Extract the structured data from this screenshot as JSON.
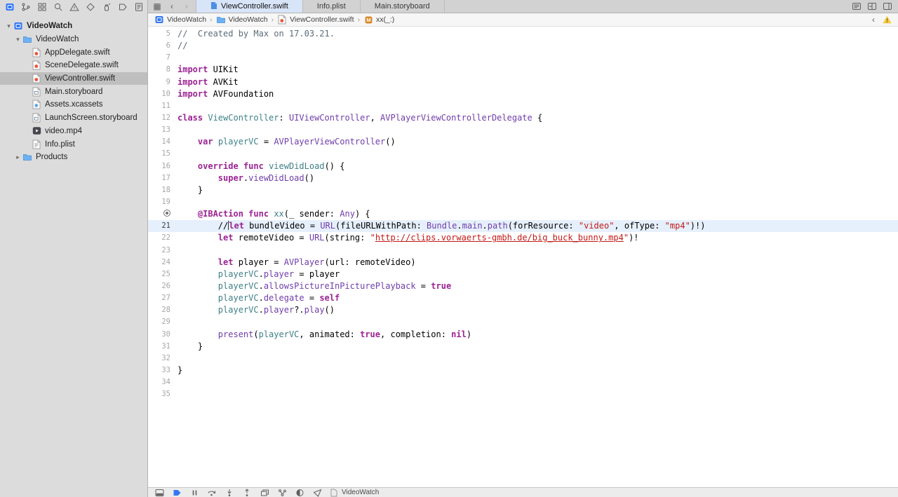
{
  "colors": {
    "accent_blue": "#3478f6",
    "active_tab_bg": "#d8e4f8",
    "highlight_line_bg": "#e6f0fc",
    "keyword": "#9b2393",
    "string": "#c41a16",
    "comment": "#5d6c79",
    "project_symbol": "#3e8087",
    "sdk_symbol": "#703daa",
    "warning_yellow": "#f7c93d",
    "swift_orange": "#f05138"
  },
  "navigator_bar": {
    "icons": [
      {
        "name": "project-navigator-icon",
        "selected": true
      },
      {
        "name": "source-control-navigator-icon",
        "selected": false
      },
      {
        "name": "symbol-navigator-icon",
        "selected": false
      },
      {
        "name": "find-navigator-icon",
        "selected": false
      },
      {
        "name": "issue-navigator-icon",
        "selected": false
      },
      {
        "name": "test-navigator-icon",
        "selected": false
      },
      {
        "name": "debug-navigator-icon",
        "selected": false
      },
      {
        "name": "breakpoint-navigator-icon",
        "selected": false
      },
      {
        "name": "report-navigator-icon",
        "selected": false
      }
    ]
  },
  "sidebar": {
    "items": [
      {
        "label": "VideoWatch",
        "icon": "project",
        "level": 0,
        "disclosure": "open",
        "selected": false,
        "bold": true
      },
      {
        "label": "VideoWatch",
        "icon": "folder",
        "level": 1,
        "disclosure": "open",
        "selected": false
      },
      {
        "label": "AppDelegate.swift",
        "icon": "swift",
        "level": 2,
        "selected": false
      },
      {
        "label": "SceneDelegate.swift",
        "icon": "swift",
        "level": 2,
        "selected": false
      },
      {
        "label": "ViewController.swift",
        "icon": "swift",
        "level": 2,
        "selected": true
      },
      {
        "label": "Main.storyboard",
        "icon": "storyboard",
        "level": 2,
        "selected": false
      },
      {
        "label": "Assets.xcassets",
        "icon": "xcassets",
        "level": 2,
        "selected": false
      },
      {
        "label": "LaunchScreen.storyboard",
        "icon": "storyboard",
        "level": 2,
        "selected": false
      },
      {
        "label": "video.mp4",
        "icon": "media",
        "level": 2,
        "selected": false
      },
      {
        "label": "Info.plist",
        "icon": "plist",
        "level": 2,
        "selected": false
      },
      {
        "label": "Products",
        "icon": "folder",
        "level": 1,
        "disclosure": "closed",
        "selected": false
      }
    ]
  },
  "tab_bar": {
    "left_icons": [
      "related-items-icon",
      "go-back-icon",
      "go-forward-icon"
    ],
    "tabs": [
      {
        "label": "ViewController.swift",
        "active": true,
        "icon": "swift-file"
      },
      {
        "label": "Info.plist",
        "active": false
      },
      {
        "label": "Main.storyboard",
        "active": false
      }
    ],
    "right_icons": [
      "editor-options-icon",
      "add-editor-icon",
      "inspector-toggle-icon"
    ]
  },
  "jump_bar": {
    "items": [
      {
        "label": "VideoWatch",
        "icon": "project"
      },
      {
        "label": "VideoWatch",
        "icon": "folder"
      },
      {
        "label": "ViewController.swift",
        "icon": "swift"
      },
      {
        "label": "xx(_:)",
        "icon": "method"
      }
    ],
    "right_icons": [
      "chevron-left-icon",
      "warning-icon"
    ]
  },
  "editor": {
    "first_visible_line": 5,
    "highlight_line": 21,
    "ibaction_line": 20,
    "lines": [
      {
        "num": 5,
        "t": [
          [
            "c",
            "//  Created by Max on 17.03.21."
          ]
        ]
      },
      {
        "num": 6,
        "t": [
          [
            "c",
            "//"
          ]
        ]
      },
      {
        "num": 7,
        "t": []
      },
      {
        "num": 8,
        "t": [
          [
            "k",
            "import"
          ],
          [
            "pl",
            " UIKit"
          ]
        ]
      },
      {
        "num": 9,
        "t": [
          [
            "k",
            "import"
          ],
          [
            "pl",
            " AVKit"
          ]
        ]
      },
      {
        "num": 10,
        "t": [
          [
            "k",
            "import"
          ],
          [
            "pl",
            " AVFoundation"
          ]
        ]
      },
      {
        "num": 11,
        "t": []
      },
      {
        "num": 12,
        "t": [
          [
            "k",
            "class"
          ],
          [
            "pl",
            " "
          ],
          [
            "t",
            "ViewController"
          ],
          [
            "pl",
            ": "
          ],
          [
            "p",
            "UIViewController"
          ],
          [
            "pl",
            ", "
          ],
          [
            "p",
            "AVPlayerViewControllerDelegate"
          ],
          [
            "pl",
            " {"
          ]
        ]
      },
      {
        "num": 13,
        "t": []
      },
      {
        "num": 14,
        "t": [
          [
            "pl",
            "    "
          ],
          [
            "k",
            "var"
          ],
          [
            "pl",
            " "
          ],
          [
            "t",
            "playerVC"
          ],
          [
            "pl",
            " = "
          ],
          [
            "p",
            "AVPlayerViewController"
          ],
          [
            "pl",
            "()"
          ]
        ]
      },
      {
        "num": 15,
        "t": []
      },
      {
        "num": 16,
        "t": [
          [
            "pl",
            "    "
          ],
          [
            "k",
            "override"
          ],
          [
            "pl",
            " "
          ],
          [
            "k",
            "func"
          ],
          [
            "pl",
            " "
          ],
          [
            "t",
            "viewDidLoad"
          ],
          [
            "pl",
            "() {"
          ]
        ]
      },
      {
        "num": 17,
        "t": [
          [
            "pl",
            "        "
          ],
          [
            "k",
            "super"
          ],
          [
            "pl",
            "."
          ],
          [
            "p",
            "viewDidLoad"
          ],
          [
            "pl",
            "()"
          ]
        ]
      },
      {
        "num": 18,
        "t": [
          [
            "pl",
            "    }"
          ]
        ]
      },
      {
        "num": 19,
        "t": []
      },
      {
        "num": 20,
        "t": [
          [
            "pl",
            "    "
          ],
          [
            "k",
            "@IBAction"
          ],
          [
            "pl",
            " "
          ],
          [
            "k",
            "func"
          ],
          [
            "pl",
            " "
          ],
          [
            "t",
            "xx"
          ],
          [
            "pl",
            "(_ sender: "
          ],
          [
            "p",
            "Any"
          ],
          [
            "pl",
            ") {"
          ]
        ]
      },
      {
        "num": 21,
        "t": [
          [
            "pl",
            "        //"
          ],
          [
            "caret",
            ""
          ],
          [
            "k",
            "let"
          ],
          [
            "pl",
            " bundleVideo = "
          ],
          [
            "p",
            "URL"
          ],
          [
            "pl",
            "(fileURLWithPath: "
          ],
          [
            "p",
            "Bundle"
          ],
          [
            "pl",
            "."
          ],
          [
            "p",
            "main"
          ],
          [
            "pl",
            "."
          ],
          [
            "p",
            "path"
          ],
          [
            "pl",
            "(forResource: "
          ],
          [
            "s",
            "\"video\""
          ],
          [
            "pl",
            ", ofType: "
          ],
          [
            "s",
            "\"mp4\""
          ],
          [
            "pl",
            ")!)"
          ]
        ]
      },
      {
        "num": 22,
        "t": [
          [
            "pl",
            "        "
          ],
          [
            "k",
            "let"
          ],
          [
            "pl",
            " remoteVideo = "
          ],
          [
            "p",
            "URL"
          ],
          [
            "pl",
            "(string: "
          ],
          [
            "s",
            "\""
          ],
          [
            "su",
            "http://clips.vorwaerts-gmbh.de/big_buck_bunny.mp4"
          ],
          [
            "s",
            "\""
          ],
          [
            "pl",
            ")!"
          ]
        ]
      },
      {
        "num": 23,
        "t": []
      },
      {
        "num": 24,
        "t": [
          [
            "pl",
            "        "
          ],
          [
            "k",
            "let"
          ],
          [
            "pl",
            " player = "
          ],
          [
            "p",
            "AVPlayer"
          ],
          [
            "pl",
            "(url: remoteVideo)"
          ]
        ]
      },
      {
        "num": 25,
        "t": [
          [
            "pl",
            "        "
          ],
          [
            "t",
            "playerVC"
          ],
          [
            "pl",
            "."
          ],
          [
            "p",
            "player"
          ],
          [
            "pl",
            " = player"
          ]
        ]
      },
      {
        "num": 26,
        "t": [
          [
            "pl",
            "        "
          ],
          [
            "t",
            "playerVC"
          ],
          [
            "pl",
            "."
          ],
          [
            "p",
            "allowsPictureInPicturePlayback"
          ],
          [
            "pl",
            " = "
          ],
          [
            "k",
            "true"
          ]
        ]
      },
      {
        "num": 27,
        "t": [
          [
            "pl",
            "        "
          ],
          [
            "t",
            "playerVC"
          ],
          [
            "pl",
            "."
          ],
          [
            "p",
            "delegate"
          ],
          [
            "pl",
            " = "
          ],
          [
            "k",
            "self"
          ]
        ]
      },
      {
        "num": 28,
        "t": [
          [
            "pl",
            "        "
          ],
          [
            "t",
            "playerVC"
          ],
          [
            "pl",
            "."
          ],
          [
            "p",
            "player"
          ],
          [
            "pl",
            "?."
          ],
          [
            "p",
            "play"
          ],
          [
            "pl",
            "()"
          ]
        ]
      },
      {
        "num": 29,
        "t": []
      },
      {
        "num": 30,
        "t": [
          [
            "pl",
            "        "
          ],
          [
            "p",
            "present"
          ],
          [
            "pl",
            "("
          ],
          [
            "t",
            "playerVC"
          ],
          [
            "pl",
            ", animated: "
          ],
          [
            "k",
            "true"
          ],
          [
            "pl",
            ", completion: "
          ],
          [
            "k",
            "nil"
          ],
          [
            "pl",
            ")"
          ]
        ]
      },
      {
        "num": 31,
        "t": [
          [
            "pl",
            "    }"
          ]
        ]
      },
      {
        "num": 32,
        "t": []
      },
      {
        "num": 33,
        "t": [
          [
            "pl",
            "}"
          ]
        ]
      },
      {
        "num": 34,
        "t": []
      },
      {
        "num": 35,
        "t": []
      }
    ]
  },
  "debug_bar": {
    "icons": [
      "hide-debug-area-icon",
      "breakpoints-toggle-icon",
      "pause-icon",
      "step-over-icon",
      "step-into-icon",
      "step-out-icon",
      "view-hierarchy-icon",
      "memory-graph-icon",
      "environment-overrides-icon",
      "simulate-location-icon"
    ],
    "process": "VideoWatch"
  }
}
